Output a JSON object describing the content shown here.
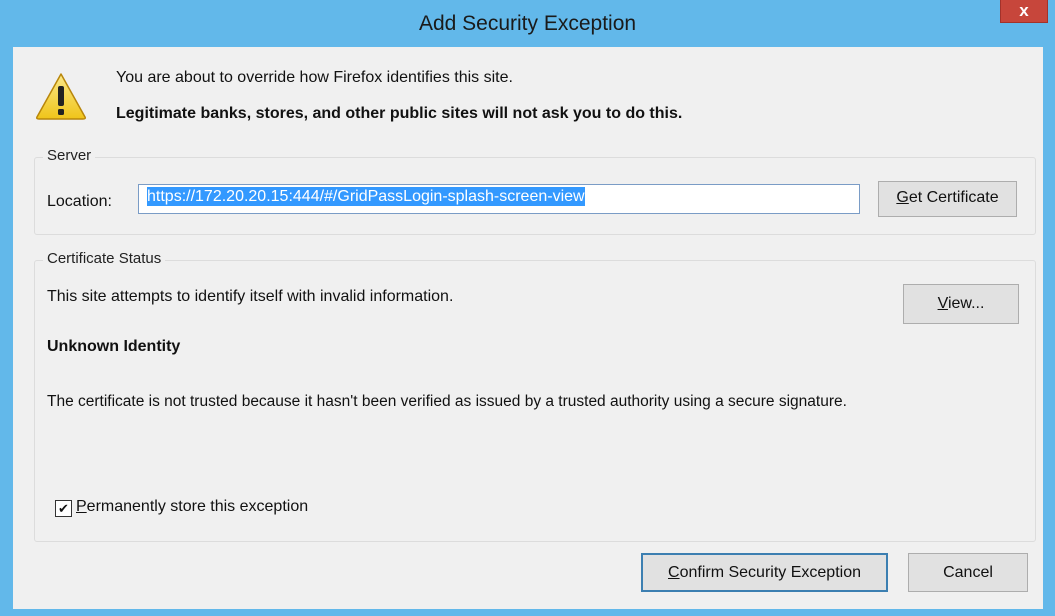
{
  "window": {
    "title": "Add Security Exception",
    "close_label": "x"
  },
  "warning": {
    "icon": "warning-icon",
    "line1": "You are about to override how Firefox identifies this site.",
    "line2": "Legitimate banks, stores, and other public sites will not ask you to do this."
  },
  "server": {
    "group_label": "Server",
    "location_label": "Location:",
    "location_value": "https://172.20.20.15:444/#/GridPassLogin-splash-screen-view",
    "get_certificate_accel": "G",
    "get_certificate_rest": "et Certificate"
  },
  "status": {
    "group_label": "Certificate Status",
    "message": "This site attempts to identify itself with invalid information.",
    "view_accel": "V",
    "view_rest": "iew...",
    "heading": "Unknown Identity",
    "description": "The certificate is not trusted because it hasn't been verified as issued by a trusted authority using a secure signature.",
    "permanent_checked": true,
    "permanent_accel": "P",
    "permanent_rest": "ermanently store this exception",
    "checkmark": "✔"
  },
  "buttons": {
    "confirm_accel": "C",
    "confirm_rest": "onfirm Security Exception",
    "cancel": "Cancel"
  },
  "colors": {
    "titlebar": "#62b8ea",
    "close": "#c7463b",
    "selection": "#3399ff",
    "warning_fill": "#f7d94c"
  }
}
